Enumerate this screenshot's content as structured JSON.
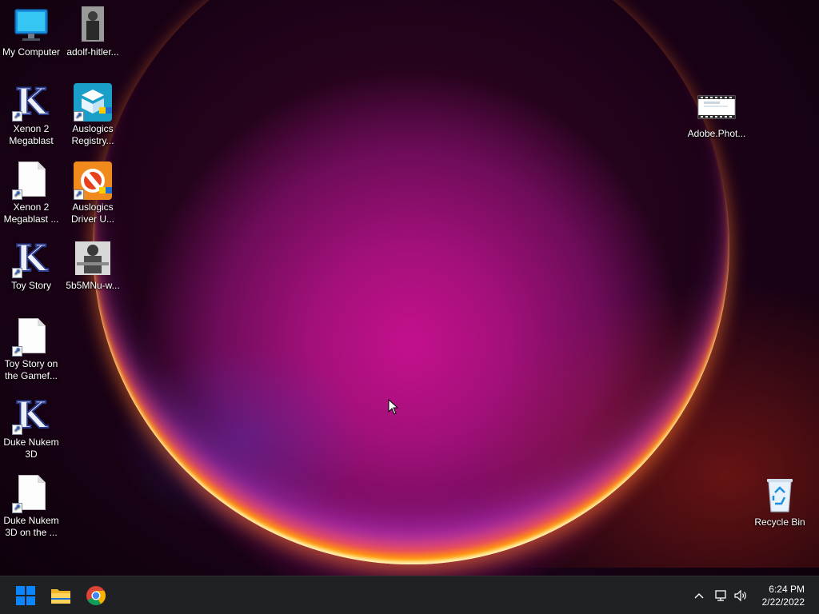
{
  "desktop": {
    "icons": [
      {
        "label": "My Computer",
        "icon": "computer-icon"
      },
      {
        "label": "adolf-hitler...",
        "icon": "photo-thumbnail-icon"
      },
      {
        "label": "Xenon 2 Megablast",
        "icon": "k-shortcut-icon"
      },
      {
        "label": "Auslogics Registry...",
        "icon": "auslogics-registry-icon"
      },
      {
        "label": "Xenon 2 Megablast ...",
        "icon": "file-shortcut-icon"
      },
      {
        "label": "Auslogics Driver U...",
        "icon": "auslogics-driver-icon"
      },
      {
        "label": "Toy Story",
        "icon": "k-shortcut-icon"
      },
      {
        "label": "5b5MNu-w...",
        "icon": "photo-thumbnail-icon"
      },
      {
        "label": "Toy Story on the Gamef...",
        "icon": "file-shortcut-icon"
      },
      {
        "label": "Duke Nukem 3D",
        "icon": "k-shortcut-icon"
      },
      {
        "label": "Duke Nukem 3D on the ...",
        "icon": "file-shortcut-icon"
      },
      {
        "label": "Adobe.Phot...",
        "icon": "video-file-icon"
      },
      {
        "label": "Recycle Bin",
        "icon": "recycle-bin-icon"
      }
    ]
  },
  "taskbar": {
    "pinned": [
      {
        "name": "Start",
        "icon": "windows-start-icon"
      },
      {
        "name": "File Explorer",
        "icon": "folder-icon"
      },
      {
        "name": "Google Chrome",
        "icon": "chrome-icon"
      }
    ],
    "tray": {
      "chevron_icon": "chevron-up-icon",
      "network_icon": "network-icon",
      "volume_icon": "volume-icon"
    },
    "clock": {
      "time": "6:24 PM",
      "date": "2/22/2022"
    }
  },
  "colors": {
    "taskbar_bg": "#202124",
    "accent_blue": "#0a84ff",
    "wallpaper_magenta": "#c4108c"
  }
}
